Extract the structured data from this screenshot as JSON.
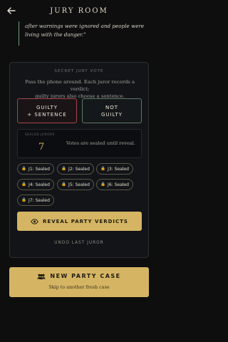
{
  "header": {
    "back_icon": "arrow-left-icon",
    "title": "JURY ROOM"
  },
  "quote": {
    "line1": "after warnings were ignored and people were",
    "line2": "living with the danger.\""
  },
  "vote_panel": {
    "heading": "SECRET JURY VOTE",
    "desc_line1": "Pass the phone around. Each juror records a verdict;",
    "desc_line2": "guilty jurors also choose a sentence.",
    "guilty_line1": "GUILTY",
    "guilty_line2": "+ SENTENCE",
    "not_guilty_line1": "NOT",
    "not_guilty_line2": "GUILTY",
    "sealed_label": "SEALED JURORS",
    "sealed_count": "7",
    "sealed_note": "Votes are sealed until reveal.",
    "jurors": [
      {
        "label": "J1: Sealed"
      },
      {
        "label": "J2: Sealed"
      },
      {
        "label": "J3: Sealed"
      },
      {
        "label": "J4: Sealed"
      },
      {
        "label": "J5: Sealed"
      },
      {
        "label": "J6: Sealed"
      },
      {
        "label": "J7: Sealed"
      }
    ],
    "reveal_label": "REVEAL PARTY VERDICTS",
    "undo_label": "UNDO LAST JUROR"
  },
  "new_case": {
    "title": "NEW PARTY CASE",
    "subtitle": "Skip to another fresh case"
  },
  "colors": {
    "background": "#0e0e0f",
    "gold": "#d5b563",
    "guilty_border": "#a8464b",
    "not_guilty_border": "#5f7a66",
    "quote_bar": "#6b9e74"
  }
}
